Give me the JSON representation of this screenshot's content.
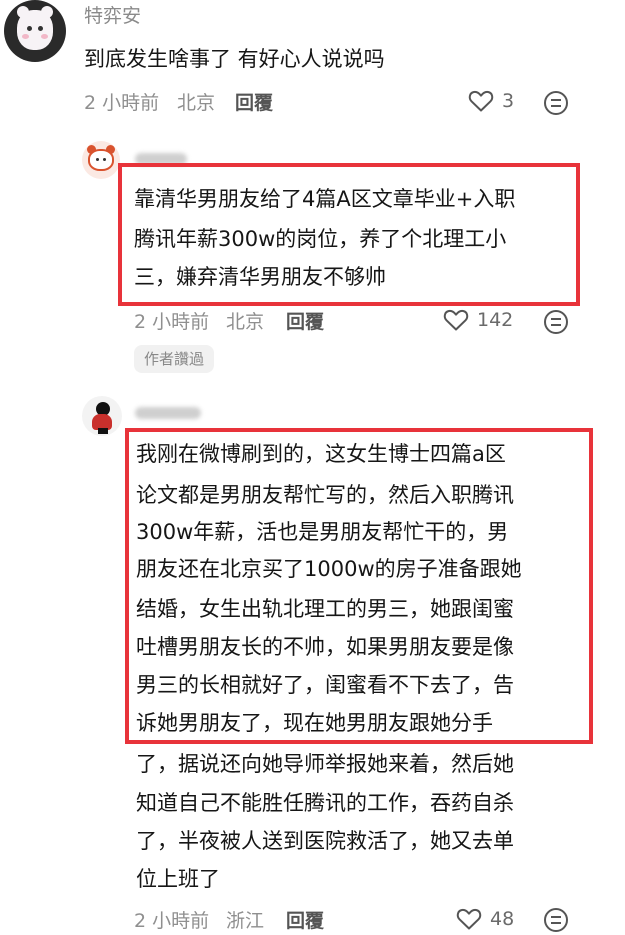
{
  "comments": [
    {
      "username": "特弈安",
      "text": "到底发生啥事了 有好心人说说吗",
      "time": "2 小時前",
      "location": "北京",
      "reply_label": "回覆",
      "likes": "3"
    },
    {
      "username": "",
      "text_lines": [
        "靠清华男朋友给了4篇A区文章毕业+入职",
        "腾讯年薪300w的岗位，养了个北理工小",
        "三，嫌弃清华男朋友不够帅"
      ],
      "time": "2 小時前",
      "location": "北京",
      "reply_label": "回覆",
      "likes": "142",
      "badge": "作者讚過"
    },
    {
      "username": "",
      "text_lines": [
        "我刚在微博刷到的，这女生博士四篇a区",
        "论文都是男朋友帮忙写的，然后入职腾讯",
        "300w年薪，活也是男朋友帮忙干的，男",
        "朋友还在北京买了1000w的房子准备跟她",
        "结婚，女生出轨北理工的男三，她跟闺蜜",
        "吐槽男朋友长的不帅，如果男朋友要是像",
        "男三的长相就好了，闺蜜看不下去了，告",
        "诉她男朋友了，现在她男朋友跟她分手",
        "了，据说还向她导师举报她来着，然后她",
        "知道自己不能胜任腾讯的工作，吞药自杀",
        "了，半夜被人送到医院救活了，她又去单",
        "位上班了"
      ],
      "time": "2 小時前",
      "location": "浙江",
      "reply_label": "回覆",
      "likes": "48"
    }
  ],
  "colors": {
    "highlight_border": "#e8333a",
    "meta_text": "#8f8f8f",
    "body_text": "#161616"
  },
  "icons": {
    "like": "heart-outline-icon",
    "more": "more-dots-icon"
  }
}
